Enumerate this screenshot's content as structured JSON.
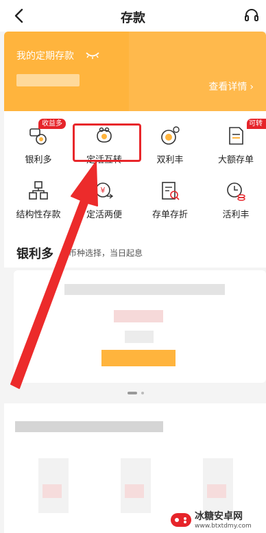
{
  "header": {
    "title": "存款",
    "back_icon": "back-arrow-icon",
    "service_icon": "headset-icon"
  },
  "banner": {
    "title": "我的定期存款",
    "detail_link": "查看详情",
    "background": "#ffb43d"
  },
  "grid": {
    "items": [
      {
        "label": "银利多",
        "icon": "coin-box-icon",
        "badge": "收益多"
      },
      {
        "label": "定活互转",
        "icon": "purse-icon"
      },
      {
        "label": "双利丰",
        "icon": "coin-icon"
      },
      {
        "label": "大额存单",
        "icon": "document-icon",
        "badge": "可转"
      },
      {
        "label": "结构性存款",
        "icon": "structure-icon"
      },
      {
        "label": "定活两便",
        "icon": "yuan-exchange-icon"
      },
      {
        "label": "存单存折",
        "icon": "passbook-icon"
      },
      {
        "label": "活利丰",
        "icon": "clock-coins-icon"
      }
    ]
  },
  "section": {
    "title": "银利多",
    "subtitle": "多币种选择，当日起息"
  },
  "watermark": {
    "name": "冰糖安卓网",
    "url": "www.btxtdmy.com"
  },
  "colors": {
    "accent": "#ffb43d",
    "highlight": "#e8262a",
    "badge": "#e6242a"
  }
}
